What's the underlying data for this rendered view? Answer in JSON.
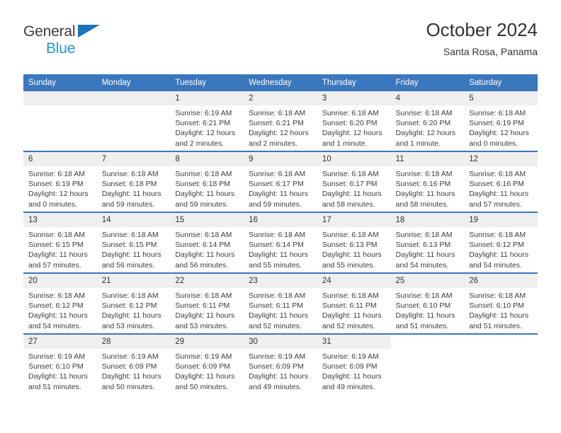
{
  "brand": {
    "name_part1": "General",
    "name_part2": "Blue",
    "accent_color": "#1b75bb",
    "accent_color_light": "#2196d9",
    "triangle_icon": "triangle-icon"
  },
  "header": {
    "title": "October 2024",
    "subtitle": "Santa Rosa, Panama"
  },
  "theme": {
    "header_bar_color": "#3b77bc",
    "daynum_band_color": "#efefef",
    "text_color": "#333333"
  },
  "weekday_headers": [
    "Sunday",
    "Monday",
    "Tuesday",
    "Wednesday",
    "Thursday",
    "Friday",
    "Saturday"
  ],
  "labels": {
    "sunrise": "Sunrise:",
    "sunset": "Sunset:",
    "daylight": "Daylight:"
  },
  "weeks": [
    {
      "days": [
        {
          "num": "",
          "sunrise": "",
          "sunset": "",
          "daylight": "",
          "empty": true
        },
        {
          "num": "",
          "sunrise": "",
          "sunset": "",
          "daylight": "",
          "empty": true
        },
        {
          "num": "1",
          "sunrise": "Sunrise: 6:19 AM",
          "sunset": "Sunset: 6:21 PM",
          "daylight": "Daylight: 12 hours and 2 minutes."
        },
        {
          "num": "2",
          "sunrise": "Sunrise: 6:18 AM",
          "sunset": "Sunset: 6:21 PM",
          "daylight": "Daylight: 12 hours and 2 minutes."
        },
        {
          "num": "3",
          "sunrise": "Sunrise: 6:18 AM",
          "sunset": "Sunset: 6:20 PM",
          "daylight": "Daylight: 12 hours and 1 minute."
        },
        {
          "num": "4",
          "sunrise": "Sunrise: 6:18 AM",
          "sunset": "Sunset: 6:20 PM",
          "daylight": "Daylight: 12 hours and 1 minute."
        },
        {
          "num": "5",
          "sunrise": "Sunrise: 6:18 AM",
          "sunset": "Sunset: 6:19 PM",
          "daylight": "Daylight: 12 hours and 0 minutes."
        }
      ]
    },
    {
      "days": [
        {
          "num": "6",
          "sunrise": "Sunrise: 6:18 AM",
          "sunset": "Sunset: 6:19 PM",
          "daylight": "Daylight: 12 hours and 0 minutes."
        },
        {
          "num": "7",
          "sunrise": "Sunrise: 6:18 AM",
          "sunset": "Sunset: 6:18 PM",
          "daylight": "Daylight: 11 hours and 59 minutes."
        },
        {
          "num": "8",
          "sunrise": "Sunrise: 6:18 AM",
          "sunset": "Sunset: 6:18 PM",
          "daylight": "Daylight: 11 hours and 59 minutes."
        },
        {
          "num": "9",
          "sunrise": "Sunrise: 6:18 AM",
          "sunset": "Sunset: 6:17 PM",
          "daylight": "Daylight: 11 hours and 59 minutes."
        },
        {
          "num": "10",
          "sunrise": "Sunrise: 6:18 AM",
          "sunset": "Sunset: 6:17 PM",
          "daylight": "Daylight: 11 hours and 58 minutes."
        },
        {
          "num": "11",
          "sunrise": "Sunrise: 6:18 AM",
          "sunset": "Sunset: 6:16 PM",
          "daylight": "Daylight: 11 hours and 58 minutes."
        },
        {
          "num": "12",
          "sunrise": "Sunrise: 6:18 AM",
          "sunset": "Sunset: 6:16 PM",
          "daylight": "Daylight: 11 hours and 57 minutes."
        }
      ]
    },
    {
      "days": [
        {
          "num": "13",
          "sunrise": "Sunrise: 6:18 AM",
          "sunset": "Sunset: 6:15 PM",
          "daylight": "Daylight: 11 hours and 57 minutes."
        },
        {
          "num": "14",
          "sunrise": "Sunrise: 6:18 AM",
          "sunset": "Sunset: 6:15 PM",
          "daylight": "Daylight: 11 hours and 56 minutes."
        },
        {
          "num": "15",
          "sunrise": "Sunrise: 6:18 AM",
          "sunset": "Sunset: 6:14 PM",
          "daylight": "Daylight: 11 hours and 56 minutes."
        },
        {
          "num": "16",
          "sunrise": "Sunrise: 6:18 AM",
          "sunset": "Sunset: 6:14 PM",
          "daylight": "Daylight: 11 hours and 55 minutes."
        },
        {
          "num": "17",
          "sunrise": "Sunrise: 6:18 AM",
          "sunset": "Sunset: 6:13 PM",
          "daylight": "Daylight: 11 hours and 55 minutes."
        },
        {
          "num": "18",
          "sunrise": "Sunrise: 6:18 AM",
          "sunset": "Sunset: 6:13 PM",
          "daylight": "Daylight: 11 hours and 54 minutes."
        },
        {
          "num": "19",
          "sunrise": "Sunrise: 6:18 AM",
          "sunset": "Sunset: 6:12 PM",
          "daylight": "Daylight: 11 hours and 54 minutes."
        }
      ]
    },
    {
      "days": [
        {
          "num": "20",
          "sunrise": "Sunrise: 6:18 AM",
          "sunset": "Sunset: 6:12 PM",
          "daylight": "Daylight: 11 hours and 54 minutes."
        },
        {
          "num": "21",
          "sunrise": "Sunrise: 6:18 AM",
          "sunset": "Sunset: 6:12 PM",
          "daylight": "Daylight: 11 hours and 53 minutes."
        },
        {
          "num": "22",
          "sunrise": "Sunrise: 6:18 AM",
          "sunset": "Sunset: 6:11 PM",
          "daylight": "Daylight: 11 hours and 53 minutes."
        },
        {
          "num": "23",
          "sunrise": "Sunrise: 6:18 AM",
          "sunset": "Sunset: 6:11 PM",
          "daylight": "Daylight: 11 hours and 52 minutes."
        },
        {
          "num": "24",
          "sunrise": "Sunrise: 6:18 AM",
          "sunset": "Sunset: 6:11 PM",
          "daylight": "Daylight: 11 hours and 52 minutes."
        },
        {
          "num": "25",
          "sunrise": "Sunrise: 6:18 AM",
          "sunset": "Sunset: 6:10 PM",
          "daylight": "Daylight: 11 hours and 51 minutes."
        },
        {
          "num": "26",
          "sunrise": "Sunrise: 6:18 AM",
          "sunset": "Sunset: 6:10 PM",
          "daylight": "Daylight: 11 hours and 51 minutes."
        }
      ]
    },
    {
      "days": [
        {
          "num": "27",
          "sunrise": "Sunrise: 6:19 AM",
          "sunset": "Sunset: 6:10 PM",
          "daylight": "Daylight: 11 hours and 51 minutes."
        },
        {
          "num": "28",
          "sunrise": "Sunrise: 6:19 AM",
          "sunset": "Sunset: 6:09 PM",
          "daylight": "Daylight: 11 hours and 50 minutes."
        },
        {
          "num": "29",
          "sunrise": "Sunrise: 6:19 AM",
          "sunset": "Sunset: 6:09 PM",
          "daylight": "Daylight: 11 hours and 50 minutes."
        },
        {
          "num": "30",
          "sunrise": "Sunrise: 6:19 AM",
          "sunset": "Sunset: 6:09 PM",
          "daylight": "Daylight: 11 hours and 49 minutes."
        },
        {
          "num": "31",
          "sunrise": "Sunrise: 6:19 AM",
          "sunset": "Sunset: 6:09 PM",
          "daylight": "Daylight: 11 hours and 49 minutes."
        },
        {
          "num": "",
          "sunrise": "",
          "sunset": "",
          "daylight": "",
          "blank": true
        },
        {
          "num": "",
          "sunrise": "",
          "sunset": "",
          "daylight": "",
          "blank": true
        }
      ]
    }
  ]
}
